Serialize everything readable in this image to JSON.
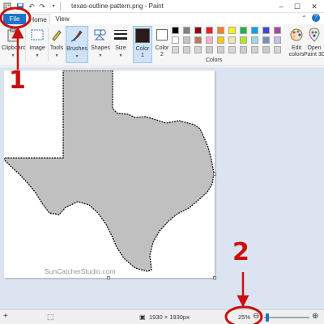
{
  "window": {
    "title": "texas-outline-pattern.png - Paint"
  },
  "titlebar": {
    "minimize_glyph": "–",
    "maximize_glyph": "☐",
    "close_glyph": "✕",
    "quick_access": [
      "save-icon",
      "undo-icon",
      "redo-icon",
      "customize-icon"
    ]
  },
  "tabs": [
    "File",
    "Home",
    "View"
  ],
  "ribbon": {
    "groups": [
      {
        "label": "Clipboard",
        "icon": "clipboard-icon"
      },
      {
        "label": "Image",
        "icon": "image-icon"
      },
      {
        "label": "Tools",
        "icon": "tools-icon"
      },
      {
        "label": "Brushes",
        "icon": "brushes-icon",
        "selected": true
      },
      {
        "label": "Shapes",
        "icon": "shapes-icon"
      },
      {
        "label": "Size",
        "icon": "size-icon"
      },
      {
        "label": "Color\n1",
        "icon": "color1-icon",
        "selected": true
      },
      {
        "label": "Color\n2",
        "icon": "color2-icon"
      },
      {
        "label": "Edit\ncolors",
        "icon": "edit-colors-icon"
      },
      {
        "label": "Open\nPaint 3D",
        "icon": "paint3d-icon"
      }
    ],
    "colors_label": "Colors",
    "color1": "#2a1a1a",
    "color2": "#ffffff",
    "palette": [
      [
        "#000000",
        "#7f7f7f",
        "#880015",
        "#ed1c24",
        "#ff7f27",
        "#fff200",
        "#22b14c",
        "#00a2e8",
        "#3f48cc",
        "#a349a4"
      ],
      [
        "#ffffff",
        "#c3c3c3",
        "#b97a57",
        "#ffaec9",
        "#ffc90e",
        "#efe4b0",
        "#b5e61d",
        "#99d9ea",
        "#7092be",
        "#c8bfe7"
      ],
      [
        "#d8d8d8",
        "#cfcfcf",
        "#d4d4d4",
        "#cccccc",
        "#d0d0d0",
        "#d6d6d6",
        "#cdcdcd",
        "#d2d2d2",
        "#cacaca",
        "#d5d5d5"
      ]
    ]
  },
  "canvas": {
    "watermark": "SunCatcherStudio.com",
    "shape_fill": "#c0c0c0"
  },
  "statusbar": {
    "size_text": "1930 × 1930px",
    "zoom": "25%",
    "zoom_out_glyph": "⊖",
    "zoom_in_glyph": "⊕",
    "zoom_fraction": 0.25
  },
  "annotations": {
    "mark1": "1",
    "mark2": "2",
    "color": "#c9100f"
  }
}
